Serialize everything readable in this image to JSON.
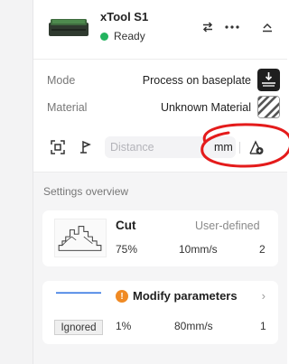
{
  "device": {
    "name": "xTool S1",
    "status": "Ready",
    "status_color": "#22b35e"
  },
  "mode": {
    "label": "Mode",
    "value": "Process on baseplate",
    "icon": "baseplate-icon"
  },
  "material": {
    "label": "Material",
    "value": "Unknown Material",
    "icon": "unknown-material-swatch"
  },
  "measure": {
    "distance_placeholder": "Distance",
    "distance_value": "",
    "unit": "mm"
  },
  "overview": {
    "title": "Settings overview",
    "items": [
      {
        "name": "Cut",
        "preset": "User-defined",
        "power": "75%",
        "speed": "10mm/s",
        "passes": "2"
      },
      {
        "name": "Modify parameters",
        "power": "1%",
        "speed": "80mm/s",
        "passes": "1",
        "badge": "Ignored",
        "warning_color": "#f08a24"
      }
    ]
  },
  "colors": {
    "annotation_circle": "#e41b1b",
    "ready_dot": "#22b35e",
    "warning": "#f08a24"
  }
}
